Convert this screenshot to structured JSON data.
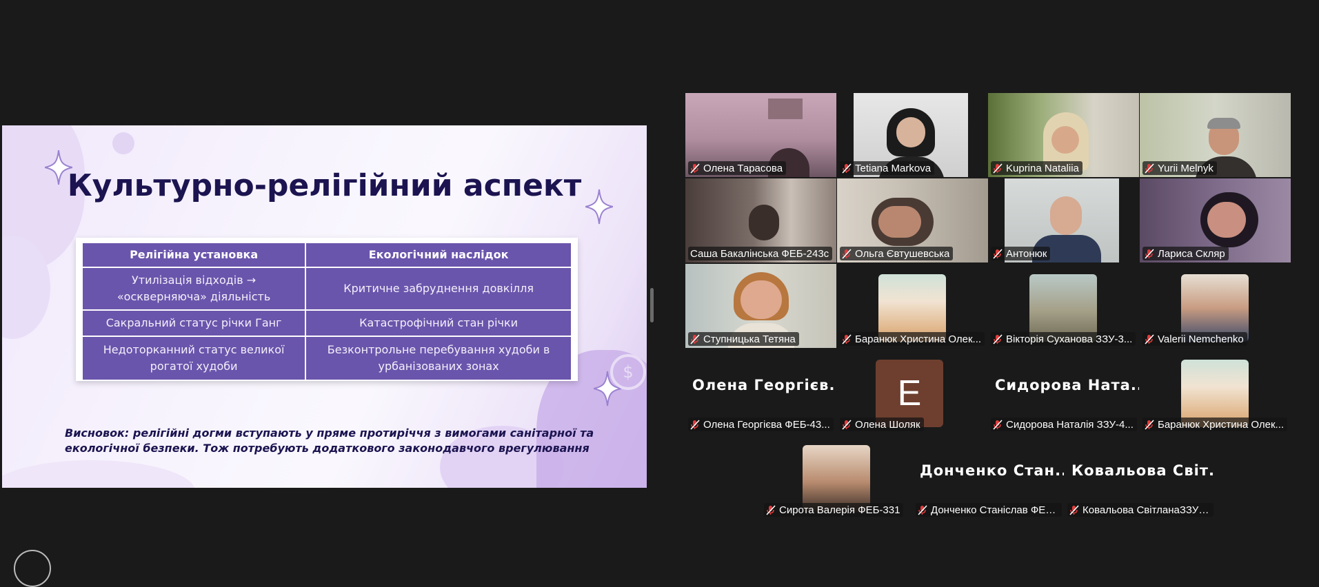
{
  "slide": {
    "title": "Культурно-релігійний аспект",
    "table": {
      "headers": [
        "Релігійна установка",
        "Екологічний наслідок"
      ],
      "rows": [
        [
          "Утилізація відходів → «оскверняюча» діяльність",
          "Критичне забруднення довкілля"
        ],
        [
          "Сакральний статус річки Ганг",
          "Катастрофічний стан річки"
        ],
        [
          "Недоторканний статус великої рогатої худоби",
          "Безконтрольне перебування худоби в урбанізованих зонах"
        ]
      ]
    },
    "conclusion_line1": "Висновок: релігійні догми вступають у пряме протиріччя з вимогами санітарної та",
    "conclusion_line2": "екологічної безпеки. Тож потребують додаткового законодавчого врегулювання",
    "coin_icon": "$"
  },
  "gallery": {
    "accent_speaking": "#2dd178",
    "participants": [
      {
        "name": "Олена Тарасова",
        "muted": true,
        "video": "woman-room"
      },
      {
        "name": "Tetiana Markova",
        "muted": true,
        "video": "woman-dark-hair"
      },
      {
        "name": "Kuprina Nataliia",
        "muted": true,
        "video": "woman-blonde-plants"
      },
      {
        "name": "Yurii Melnyk",
        "muted": true,
        "video": "man-grey-hair"
      },
      {
        "name": "Саша Бакалінська ФЕБ-243с",
        "muted": false,
        "speaking": true,
        "video": "woman-window"
      },
      {
        "name": "Ольга Євтушевська",
        "muted": true,
        "video": "woman-glasses"
      },
      {
        "name": "Антонюк",
        "muted": true,
        "video": "man-suit"
      },
      {
        "name": "Лариса Скляр",
        "muted": true,
        "video": "woman-phone"
      },
      {
        "name": "Ступницька Тетяна",
        "muted": true,
        "video": "woman-glasses-blonde"
      },
      {
        "name": "Баранюк Христина Олек...",
        "muted": true,
        "video": "avatar-blonde-girl"
      },
      {
        "name": "Вікторія Суханова ЗЗУ-3...",
        "muted": true,
        "video": "avatar-street"
      },
      {
        "name": "Valerii Nemchenko",
        "muted": true,
        "video": "avatar-man-glasses"
      },
      {
        "name": "Олена Георгієва ФЕБ-43...",
        "muted": true,
        "display_name": "Олена Георгієв..."
      },
      {
        "name": "Олена Шоляк",
        "muted": true,
        "avatar_letter": "E"
      },
      {
        "name": "Сидорова Наталія ЗЗУ-4...",
        "muted": true,
        "display_name": "Сидорова Ната..."
      },
      {
        "name": "Баранюк Христина Олек...",
        "muted": true,
        "video": "avatar-blonde-girl"
      },
      {
        "name": "Сирота Валерія ФЕБ-331",
        "muted": true,
        "video": "avatar-girl-selfie"
      },
      {
        "name": "Донченко Станіслав ФЕБ...",
        "muted": true,
        "display_name": "Донченко Стан..."
      },
      {
        "name": "Ковальова СвітланаЗЗУ4...",
        "muted": true,
        "display_name": "Ковальова Світ..."
      }
    ]
  }
}
